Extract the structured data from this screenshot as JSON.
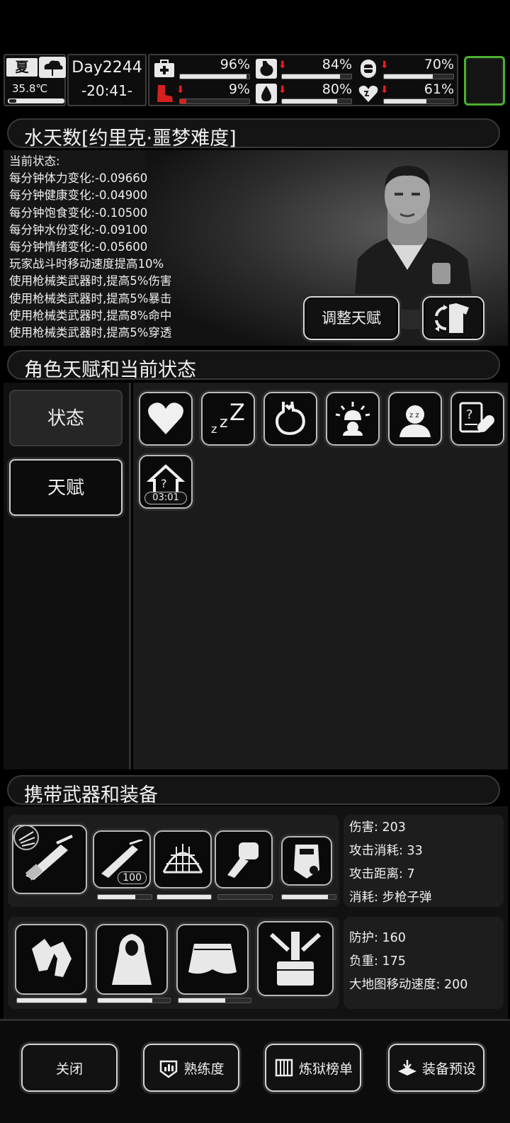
{
  "topbar": {
    "season": "夏",
    "temperature": "35.8℃",
    "temperature_level": 0.15,
    "day": "Day2244",
    "time": "-20:41-",
    "stats": [
      {
        "name": "health",
        "value": "96%",
        "level": 0.96,
        "arrow": false
      },
      {
        "name": "hunger",
        "value": "84%",
        "level": 0.84,
        "arrow": true
      },
      {
        "name": "stamina",
        "value": "70%",
        "level": 0.7,
        "arrow": true
      },
      {
        "name": "injury",
        "value": "9%",
        "level": 0.09,
        "arrow": true
      },
      {
        "name": "water",
        "value": "80%",
        "level": 0.8,
        "arrow": true
      },
      {
        "name": "mood",
        "value": "61%",
        "level": 0.61,
        "arrow": true
      }
    ]
  },
  "character": {
    "title": "水天数[约里克·噩梦难度]",
    "status_heading": "当前状态:",
    "status_lines": [
      "每分钟体力变化:-0.09660",
      "每分钟健康变化:-0.04900",
      "每分钟饱食变化:-0.10500",
      "每分钟水份变化:-0.09100",
      "每分钟情绪变化:-0.05600",
      "玩家战斗时移动速度提高10%",
      "使用枪械类武器时,提高5%伤害",
      "使用枪械类武器时,提高5%暴击",
      "使用枪械类武器时,提高8%命中",
      "使用枪械类武器时,提高5%穿透"
    ],
    "adjust_talent_button": "调整天赋"
  },
  "talent_section": {
    "title": "角色天赋和当前状态",
    "tab_status": "状态",
    "tab_talent": "天赋",
    "status_icons": [
      "heart-icon",
      "sleep-icon",
      "stomach-icon",
      "alarm-icon",
      "tired-icon",
      "medicine-icon",
      "shelter-icon"
    ],
    "shelter_timer": "03:01"
  },
  "equipment": {
    "title": "携带武器和装备",
    "weapon_info": [
      "伤害: 203",
      "攻击消耗: 33",
      "攻击距离: 7",
      "消耗: 步枪子弹"
    ],
    "ammo_count": "100",
    "weapon_durability": [
      1.0,
      0.7,
      1.0,
      0.0,
      0.85
    ],
    "armor_info": [
      "防护: 160",
      "负重: 175",
      "大地图移动速度: 200"
    ],
    "armor_durability": [
      1.0,
      0.75,
      0.65,
      0.0
    ]
  },
  "bottom_buttons": {
    "close": "关闭",
    "proficiency": "熟练度",
    "prison_rank": "炼狱榜单",
    "equip_preset": "装备预设"
  }
}
